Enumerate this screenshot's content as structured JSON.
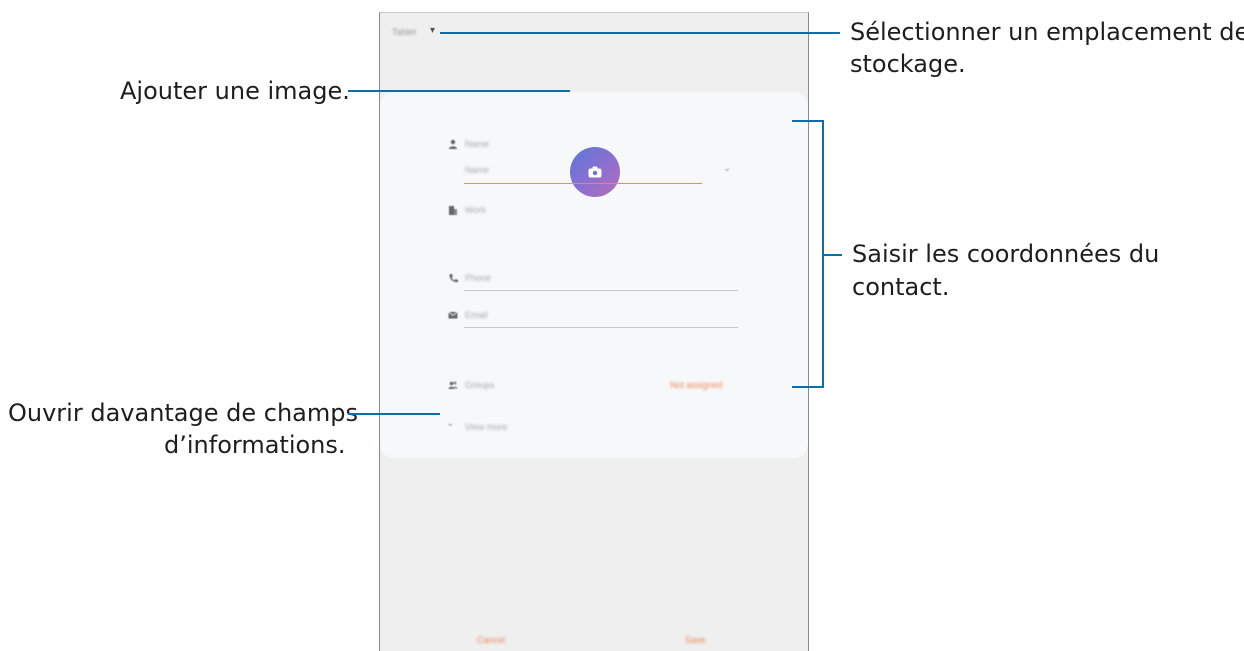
{
  "screen": {
    "storage_label": "Tablet",
    "fields": {
      "name_header": "Name",
      "name_placeholder": "Name",
      "work": "Work",
      "phone": "Phone",
      "email": "Email",
      "groups": "Groups",
      "groups_value": "Not assigned",
      "view_more": "View more"
    },
    "buttons": {
      "cancel": "Cancel",
      "save": "Save"
    }
  },
  "callouts": {
    "storage": [
      "Sélectionner un emplacement de",
      "stockage."
    ],
    "image": "Ajouter une image.",
    "contact": [
      "Saisir les coordonnées du",
      "contact."
    ],
    "more": [
      "Ouvrir davantage de champs",
      "d’informations."
    ]
  },
  "colors": {
    "callout_line": "#0e6ea8",
    "accent": "#e8865a",
    "avatar_start": "#5a78d6",
    "avatar_end": "#b56fb8"
  }
}
